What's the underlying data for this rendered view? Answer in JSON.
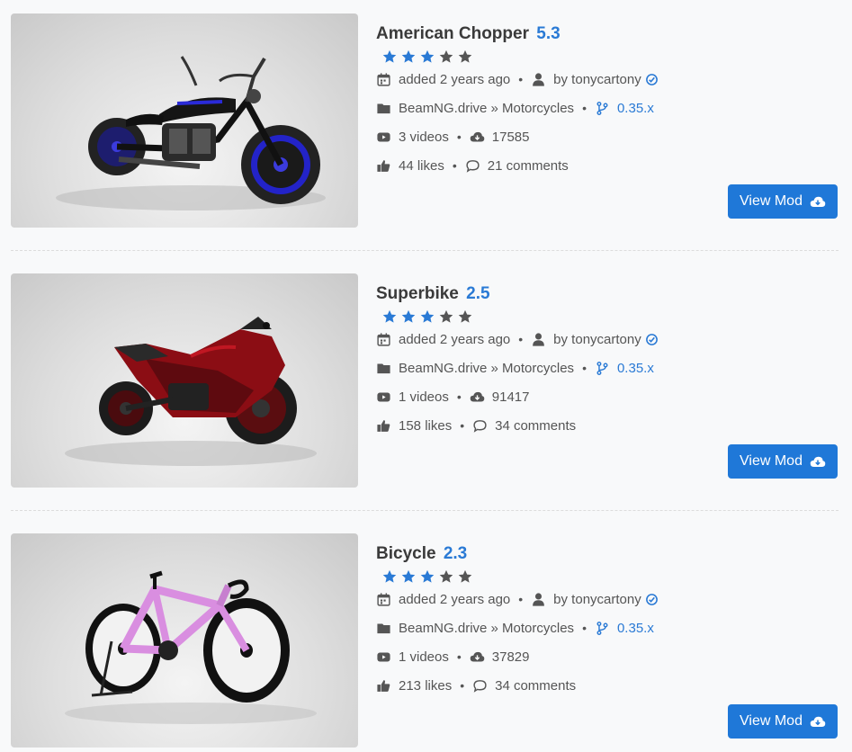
{
  "mods": [
    {
      "title": "American Chopper",
      "version": "5.3",
      "rating_stars": 3,
      "added": "added 2 years ago",
      "author": "by tonycartony",
      "category": "BeamNG.drive » Motorcycles",
      "game_version": "0.35.x",
      "videos": "3 videos",
      "downloads": "17585",
      "likes": "44 likes",
      "comments": "21 comments",
      "button_label": "View Mod",
      "image": "chopper-motorcycle-image"
    },
    {
      "title": "Superbike",
      "version": "2.5",
      "rating_stars": 3,
      "added": "added 2 years ago",
      "author": "by tonycartony",
      "category": "BeamNG.drive » Motorcycles",
      "game_version": "0.35.x",
      "videos": "1 videos",
      "downloads": "91417",
      "likes": "158 likes",
      "comments": "34 comments",
      "button_label": "View Mod",
      "image": "superbike-motorcycle-image"
    },
    {
      "title": "Bicycle",
      "version": "2.3",
      "rating_stars": 3,
      "added": "added 2 years ago",
      "author": "by tonycartony",
      "category": "BeamNG.drive » Motorcycles",
      "game_version": "0.35.x",
      "videos": "1 videos",
      "downloads": "37829",
      "likes": "213 likes",
      "comments": "34 comments",
      "button_label": "View Mod",
      "image": "bicycle-image"
    }
  ],
  "colors": {
    "accent": "#2a7ad5",
    "button": "#1f78d8",
    "star_filled": "#2a7ad5",
    "star_empty": "#555555",
    "text": "#555555",
    "title": "#3a3a3a"
  }
}
